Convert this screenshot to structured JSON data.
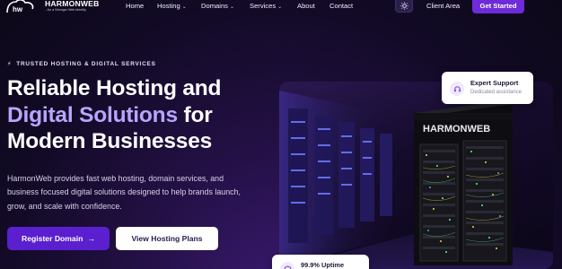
{
  "brand": {
    "name": "HARMONWEB",
    "tagline": "...for a Stronger Web Identity"
  },
  "nav": {
    "items": [
      {
        "label": "Home",
        "has_menu": false
      },
      {
        "label": "Hosting",
        "has_menu": true
      },
      {
        "label": "Domains",
        "has_menu": true
      },
      {
        "label": "Services",
        "has_menu": true
      },
      {
        "label": "About",
        "has_menu": false
      },
      {
        "label": "Contact",
        "has_menu": false
      }
    ],
    "theme_icon": "sun-icon",
    "client_area": "Client Area",
    "get_started": "Get Started"
  },
  "hero": {
    "eyebrow": "TRUSTED HOSTING & DIGITAL SERVICES",
    "eyebrow_icon": "bolt-icon",
    "headline_line1": "Reliable Hosting and",
    "headline_accent": "Digital Solutions",
    "headline_line2_rest": " for",
    "headline_line3": "Modern Businesses",
    "description": "HarmonWeb provides fast web hosting, domain services, and business focused digital solutions designed to help brands launch, grow, and scale with confidence.",
    "primary_cta": "Register Domain",
    "primary_cta_icon": "arrow-right-icon",
    "secondary_cta": "View Hosting Plans"
  },
  "server_rack_label": "HARMONWEB",
  "cards": {
    "support": {
      "title": "Expert Support",
      "subtitle": "Dedicated assistance",
      "icon": "headset-icon"
    },
    "uptime": {
      "title": "99.9% Uptime",
      "icon": "shield-icon"
    }
  },
  "colors": {
    "accent": "#6d2bd9",
    "primary_button": "#5b1fd0",
    "headline_accent": "#b9a5ff",
    "background": "#120a26"
  }
}
